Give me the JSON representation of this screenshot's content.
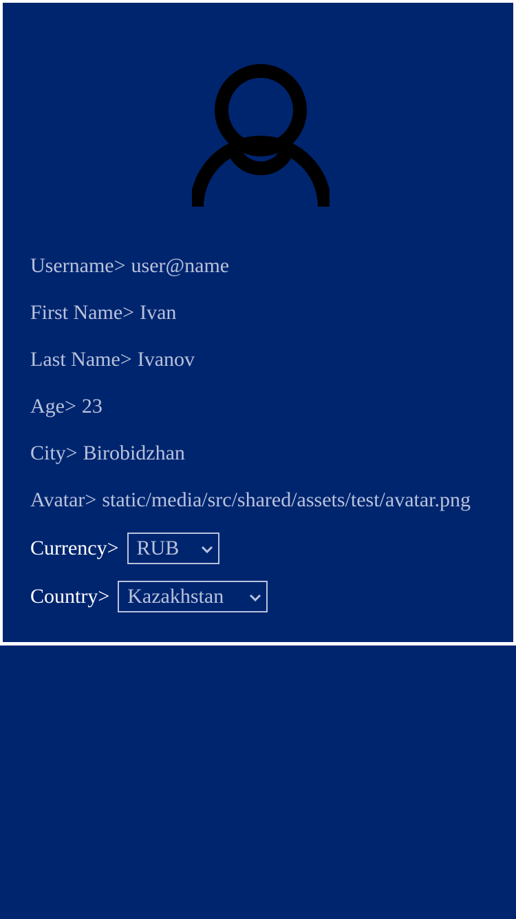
{
  "profile": {
    "username": {
      "label": "Username>",
      "value": "user@name"
    },
    "first_name": {
      "label": "First Name>",
      "value": "Ivan"
    },
    "last_name": {
      "label": "Last Name>",
      "value": "Ivanov"
    },
    "age": {
      "label": "Age>",
      "value": "23"
    },
    "city": {
      "label": "City>",
      "value": "Birobidzhan"
    },
    "avatar": {
      "label": "Avatar>",
      "value": "static/media/src/shared/assets/test/avatar.png"
    },
    "currency": {
      "label": "Currency>",
      "value": "RUB"
    },
    "country": {
      "label": "Country>",
      "value": "Kazakhstan"
    }
  },
  "icons": {
    "avatar": "user-icon",
    "select_arrow": "chevron-down-icon"
  },
  "colors": {
    "background": "#00256f",
    "field_text": "#b8c3dc",
    "select_label_text": "#ffffff",
    "avatar_icon": "#000000"
  }
}
